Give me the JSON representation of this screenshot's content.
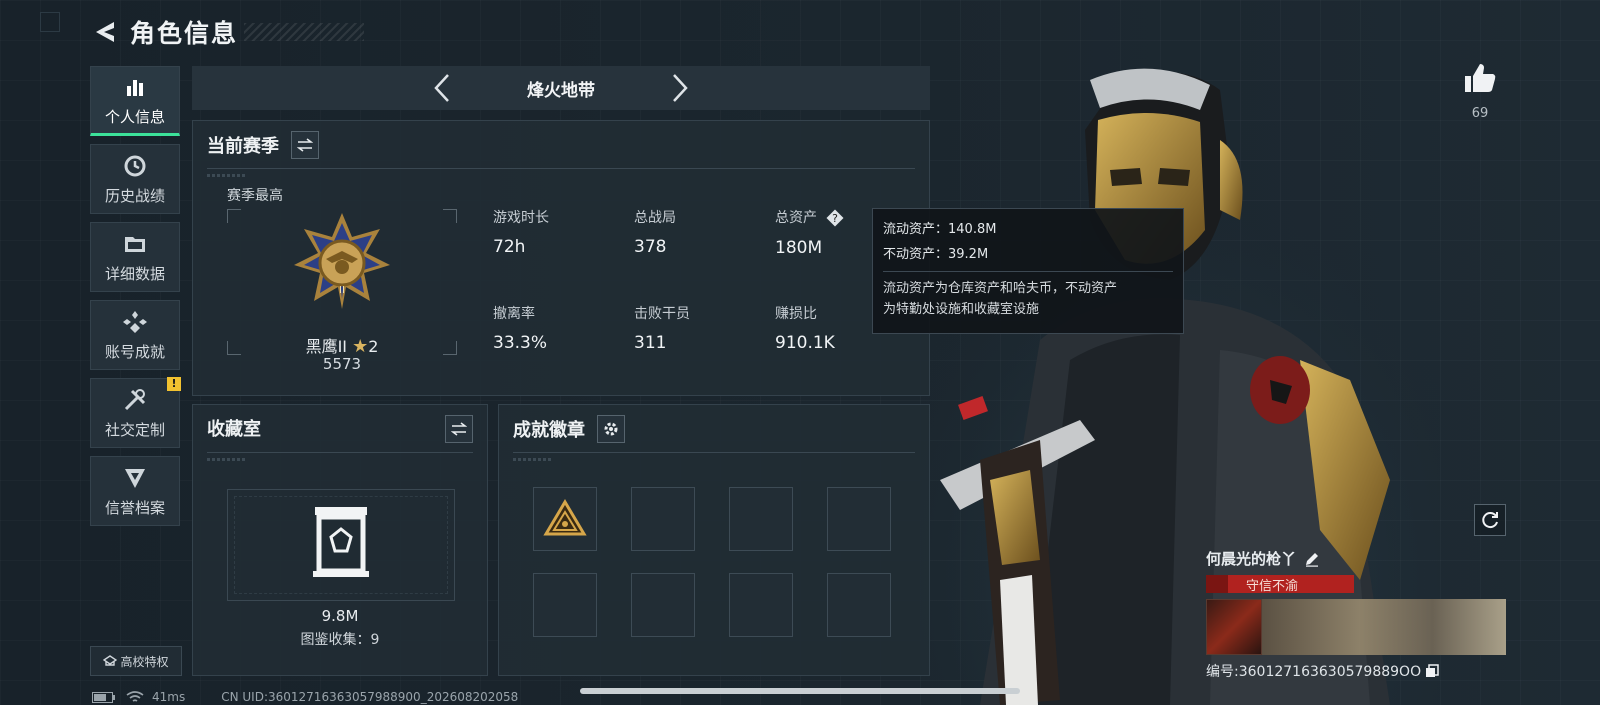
{
  "header": {
    "title": "角色信息"
  },
  "sidebar": {
    "items": [
      {
        "label": "个人信息",
        "icon": "bar-chart-icon",
        "active": true
      },
      {
        "label": "历史战绩",
        "icon": "history-clock-icon"
      },
      {
        "label": "详细数据",
        "icon": "folder-icon"
      },
      {
        "label": "账号成就",
        "icon": "achievement-icon"
      },
      {
        "label": "社交定制",
        "icon": "tools-icon",
        "badge": "!"
      },
      {
        "label": "信誉档案",
        "icon": "credit-shield-icon"
      }
    ],
    "school_label": "高校特权"
  },
  "mode": {
    "title": "烽火地带"
  },
  "season": {
    "title": "当前赛季",
    "best_label": "赛季最高",
    "rank_name": "黑鹰II",
    "rank_stars": "2",
    "rank_score": "5573",
    "stats": [
      {
        "label": "游戏时长",
        "value": "72h"
      },
      {
        "label": "总战局",
        "value": "378"
      },
      {
        "label": "总资产",
        "value": "180M"
      },
      {
        "label": "撤离率",
        "value": "33.3%"
      },
      {
        "label": "击败干员",
        "value": "311"
      },
      {
        "label": "赚损比",
        "value": "910.1K"
      }
    ]
  },
  "tooltip": {
    "liquid": "流动资产：140.8M",
    "fixed": "不动资产：39.2M",
    "note_line1": "流动资产为仓库资产和哈夫币，不动资产",
    "note_line2": "为特勤处设施和收藏室设施"
  },
  "collection": {
    "title": "收藏室",
    "value": "9.8M",
    "count": "图鉴收集：9"
  },
  "badges": {
    "title": "成就徽章"
  },
  "player": {
    "likes": "69",
    "name": "何晨光的枪丫",
    "title_text": "守信不渝",
    "id": "编号:360127163630579889OO"
  },
  "status": {
    "ping": "41ms",
    "uid": "CN UID:36012716363057988900_202608202058"
  },
  "colors": {
    "accent": "#3ce29a",
    "title_red": "#b1221f",
    "panel": "#212c34"
  }
}
